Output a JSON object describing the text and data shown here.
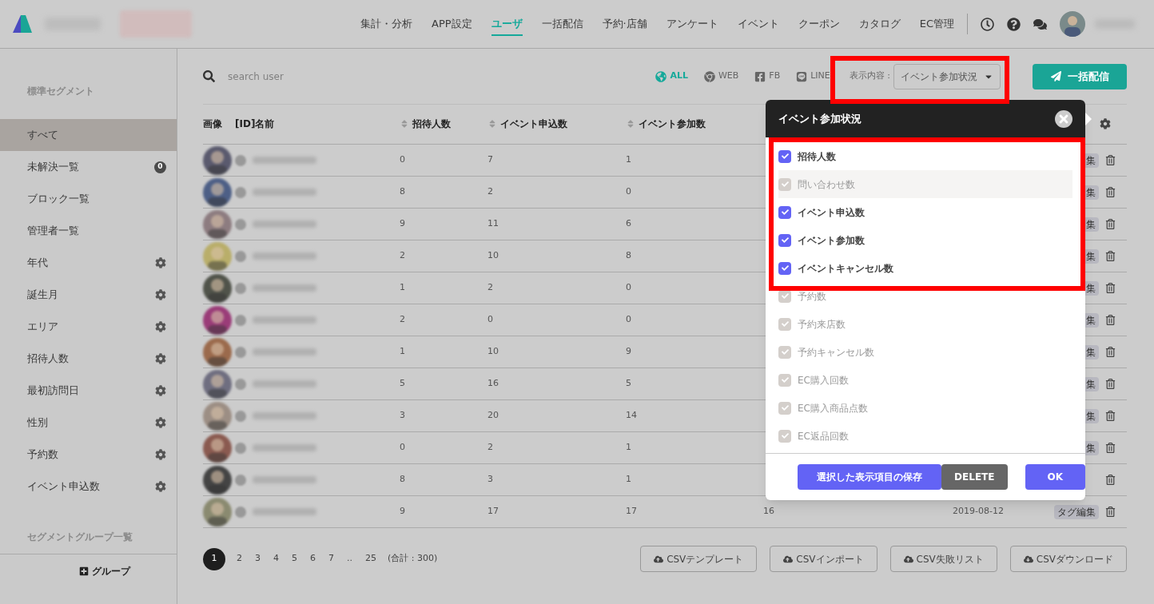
{
  "nav": {
    "items": [
      {
        "label": "集計・分析",
        "selected": false
      },
      {
        "label": "APP設定",
        "selected": false
      },
      {
        "label": "ユーザ",
        "selected": true
      },
      {
        "label": "一括配信",
        "selected": false
      },
      {
        "label": "予約·店舗",
        "selected": false
      },
      {
        "label": "アンケート",
        "selected": false
      },
      {
        "label": "イベント",
        "selected": false
      },
      {
        "label": "クーポン",
        "selected": false
      },
      {
        "label": "カタログ",
        "selected": false
      },
      {
        "label": "EC管理",
        "selected": false
      }
    ]
  },
  "sidebar": {
    "section_title": "標準セグメント",
    "items": [
      {
        "label": "すべて",
        "selected": true
      },
      {
        "label": "未解決一覧",
        "selected": false,
        "badge": "0"
      },
      {
        "label": "ブロック一覧",
        "selected": false
      },
      {
        "label": "管理者一覧",
        "selected": false
      },
      {
        "label": "年代",
        "selected": false,
        "settings": true
      },
      {
        "label": "誕生月",
        "selected": false,
        "settings": true
      },
      {
        "label": "エリア",
        "selected": false,
        "settings": true
      },
      {
        "label": "招待人数",
        "selected": false,
        "settings": true
      },
      {
        "label": "最初訪問日",
        "selected": false,
        "settings": true
      },
      {
        "label": "性別",
        "selected": false,
        "settings": true
      },
      {
        "label": "予約数",
        "selected": false,
        "settings": true
      },
      {
        "label": "イベント申込数",
        "selected": false,
        "settings": true
      }
    ],
    "group_title": "セグメントグループ一覧",
    "group_button": "グループ"
  },
  "toolbar": {
    "search": {
      "placeholder": "search user"
    },
    "filters": [
      {
        "label": "ALL",
        "kind": "globe",
        "selected": true
      },
      {
        "label": "WEB",
        "kind": "chrome",
        "selected": false
      },
      {
        "label": "FB",
        "kind": "facebook",
        "selected": false
      },
      {
        "label": "LINE",
        "kind": "line",
        "selected": false
      }
    ],
    "display_label": "表示内容 :",
    "display_value": "イベント参加状況",
    "send_button": "一括配信"
  },
  "table": {
    "columns": [
      "画像",
      "[ID]名前",
      "招待人数",
      "イベント申込数",
      "イベント参加数"
    ],
    "rows": [
      {
        "cells": [
          "0",
          "7",
          "1"
        ],
        "tag": "集"
      },
      {
        "cells": [
          "8",
          "2",
          "0"
        ],
        "tag": "集"
      },
      {
        "cells": [
          "9",
          "11",
          "6"
        ],
        "tag": "集"
      },
      {
        "cells": [
          "2",
          "10",
          "8"
        ],
        "tag": "集"
      },
      {
        "cells": [
          "1",
          "2",
          "0"
        ],
        "tag": "集"
      },
      {
        "cells": [
          "2",
          "0",
          "0"
        ],
        "tag": "集"
      },
      {
        "cells": [
          "1",
          "10",
          "9"
        ],
        "tag": "集"
      },
      {
        "cells": [
          "5",
          "16",
          "5"
        ],
        "tag": "集"
      },
      {
        "cells": [
          "3",
          "20",
          "14"
        ],
        "tag": "集"
      },
      {
        "cells": [
          "0",
          "2",
          "1"
        ],
        "tag": "集"
      },
      {
        "cells": [
          "8",
          "3",
          "1"
        ]
      },
      {
        "cells": [
          "9",
          "17",
          "17"
        ],
        "column_4": "16",
        "date": "2019-08-12",
        "tag": "タグ編集"
      }
    ]
  },
  "pagination": {
    "pages": [
      {
        "label": "1",
        "selected": true
      },
      {
        "label": "2",
        "selected": false
      },
      {
        "label": "3",
        "selected": false
      },
      {
        "label": "4",
        "selected": false
      },
      {
        "label": "5",
        "selected": false
      },
      {
        "label": "6",
        "selected": false
      },
      {
        "label": "7",
        "selected": false
      },
      {
        "label": "..",
        "selected": false
      },
      {
        "label": "25",
        "selected": false
      }
    ],
    "total": "(合計 : 300)"
  },
  "csv_buttons": [
    "CSVテンプレート",
    "CSVインポート",
    "CSV失敗リスト",
    "CSVダウンロード"
  ],
  "popup": {
    "title": "イベント参加状況",
    "options": [
      {
        "label": "招待人数",
        "checked": true,
        "highlighted": false
      },
      {
        "label": "問い合わせ数",
        "checked": false,
        "highlighted": true
      },
      {
        "label": "イベント申込数",
        "checked": true,
        "highlighted": false
      },
      {
        "label": "イベント参加数",
        "checked": true,
        "highlighted": false
      },
      {
        "label": "イベントキャンセル数",
        "checked": true,
        "highlighted": false
      },
      {
        "label": "予約数",
        "checked": false,
        "highlighted": false
      },
      {
        "label": "予約来店数",
        "checked": false,
        "highlighted": false
      },
      {
        "label": "予約キャンセル数",
        "checked": false,
        "highlighted": false
      },
      {
        "label": "EC購入回数",
        "checked": false,
        "highlighted": false
      },
      {
        "label": "EC購入商品点数",
        "checked": false,
        "highlighted": false
      },
      {
        "label": "EC返品回数",
        "checked": false,
        "highlighted": false
      }
    ],
    "buttons": [
      {
        "label": "選択した表示項目の保存",
        "kind": "save"
      },
      {
        "label": "DELETE",
        "kind": "delete"
      },
      {
        "label": "OK",
        "kind": "ok"
      }
    ]
  }
}
